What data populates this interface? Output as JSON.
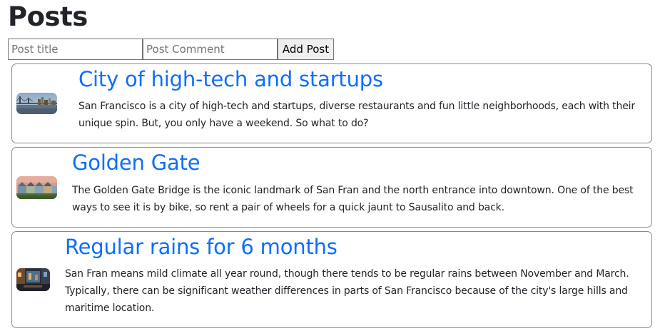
{
  "header": {
    "title": "Posts"
  },
  "form": {
    "title_placeholder": "Post title",
    "title_value": "",
    "comment_placeholder": "Post Comment",
    "comment_value": "",
    "add_label": "Add Post"
  },
  "posts": [
    {
      "title": "City of high-tech and startups",
      "text": "San Francisco is a city of high-tech and startups, diverse restaurants and fun little neighborhoods, each with their unique spin. But, you only have a weekend. So what to do?",
      "image": "bay-bridge-skyline-photo"
    },
    {
      "title": "Golden Gate",
      "text": "The Golden Gate Bridge is the iconic landmark of San Fran and the north entrance into downtown. One of the best ways to see it is by bike, so rent a pair of wheels for a quick jaunt to Sausalito and back.",
      "image": "painted-ladies-houses-photo"
    },
    {
      "title": "Regular rains for 6 months",
      "text": "San Fran means mild climate all year round, though there tends to be regular rains between November and March. Typically, there can be significant weather differences in parts of San Francisco because of the city's large hills and maritime location.",
      "image": "city-night-street-photo"
    }
  ],
  "colors": {
    "link": "#0d6efd",
    "text": "#212529",
    "border": "#8a8a8a"
  }
}
